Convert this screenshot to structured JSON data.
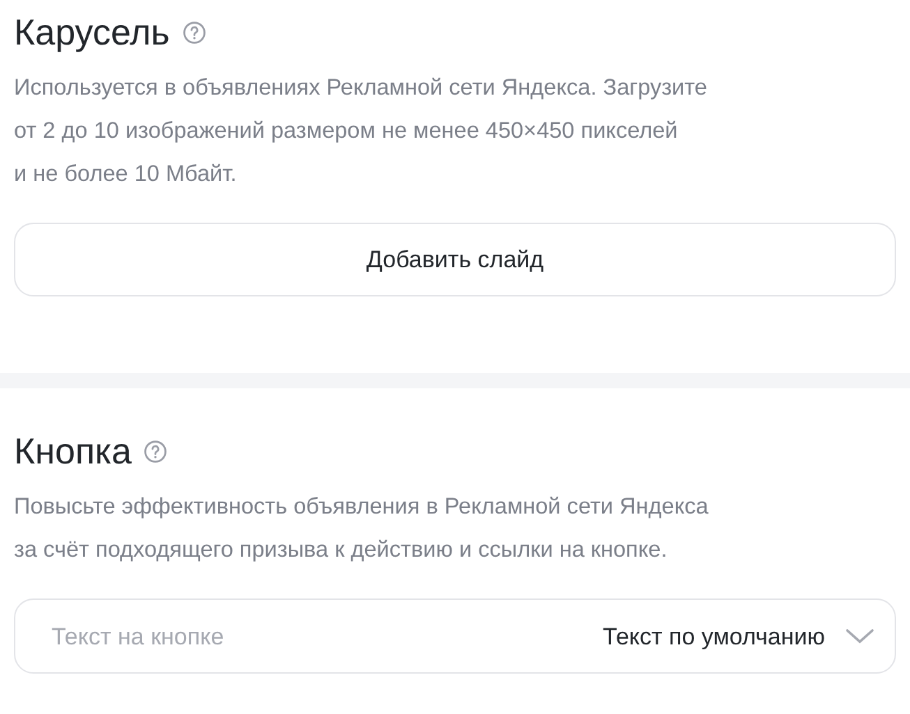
{
  "sections": [
    {
      "title": "Карусель",
      "description": "Используется в объявлениях Рекламной сети Яндекса. Загрузите\nот 2 до 10 изображений размером не менее 450×450 пикселей\nи не более 10 Мбайт.",
      "control": {
        "kind": "button",
        "label": "Добавить слайд"
      }
    },
    {
      "title": "Кнопка",
      "description": "Повысьте эффективность объявления в Рекламной сети Яндекса\nза счёт подходящего призыва к действию и ссылки на кнопке.",
      "control": {
        "kind": "field",
        "placeholder": "Текст на кнопке",
        "option": "Текст по умолчанию"
      }
    }
  ]
}
